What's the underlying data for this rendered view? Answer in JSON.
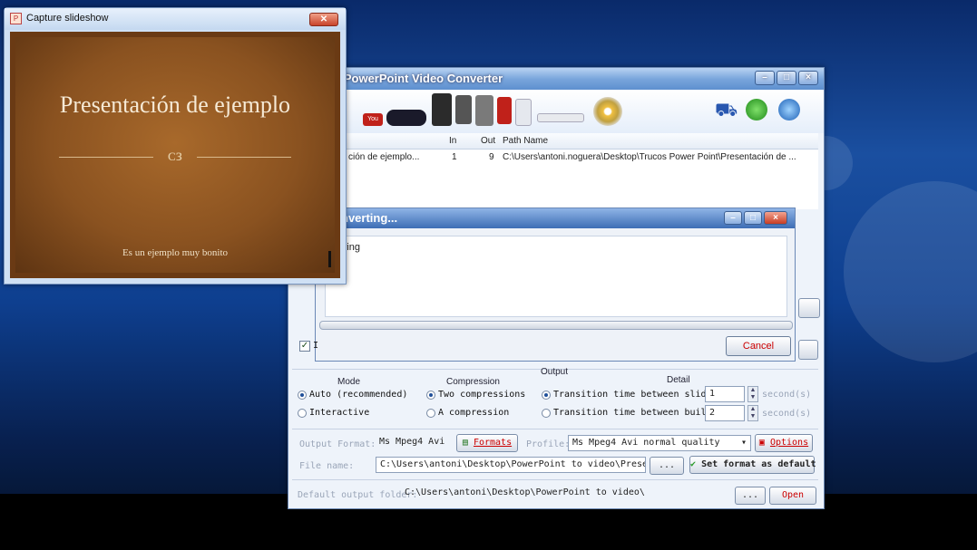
{
  "capture_window": {
    "title": "Capture slideshow",
    "close_glyph": "✕",
    "icon": "presentation-icon",
    "slide": {
      "title": "Presentación de ejemplo",
      "ornament": "ᴄᴈ",
      "subtitle": "Es un ejemplo muy bonito"
    }
  },
  "main_window": {
    "title": "e PowerPoint Video Converter",
    "list": {
      "headers": {
        "in": "In",
        "out": "Out",
        "path": "Path Name"
      },
      "rows": [
        {
          "name": "ción de ejemplo...",
          "in": "1",
          "out": "9",
          "path": "C:\\Users\\antoni.noguera\\Desktop\\Trucos Power Point\\Presentación de ..."
        }
      ]
    },
    "toolbar_icons": [
      "youtube-icon",
      "psp-icon",
      "phone-icon",
      "ipod-icon",
      "disc-icon",
      "cart-icon",
      "update-icon",
      "help-icon"
    ],
    "options": {
      "mode_label": "Mode",
      "mode_auto": "Auto (recommended)",
      "mode_interactive": "Interactive",
      "compression_label": "Compression",
      "compression_two": "Two compressions",
      "compression_one": "A compression",
      "output_label": "Output",
      "detail_label": "Detail",
      "transition_slides": "Transition time between slides",
      "transition_builds": "Transition time between builds",
      "slides_value": "1",
      "builds_value": "2",
      "seconds_unit": "second(s)",
      "output_format_label": "Output Format:",
      "output_format_value": "Ms Mpeg4 Avi",
      "formats_button": "Formats",
      "profile_label": "Profile:",
      "profile_value": "Ms Mpeg4 Avi normal quality",
      "options_button": "Options",
      "file_name_label": "File name:",
      "file_name_value": "C:\\Users\\antoni\\Desktop\\PowerPoint to video\\Presentac",
      "browse_label": "...",
      "set_default_button": "Set format as default",
      "output_folder_label": "Default output folder:",
      "output_folder_value": "C:\\Users\\antoni\\Desktop\\PowerPoint to video\\",
      "folder_browse_label": "...",
      "open_button": "Open"
    }
  },
  "converting_dialog": {
    "title": "nverting...",
    "log_text": "tstring",
    "progress": 0,
    "cancel_button": "Cancel",
    "checkbox_label": "I"
  }
}
